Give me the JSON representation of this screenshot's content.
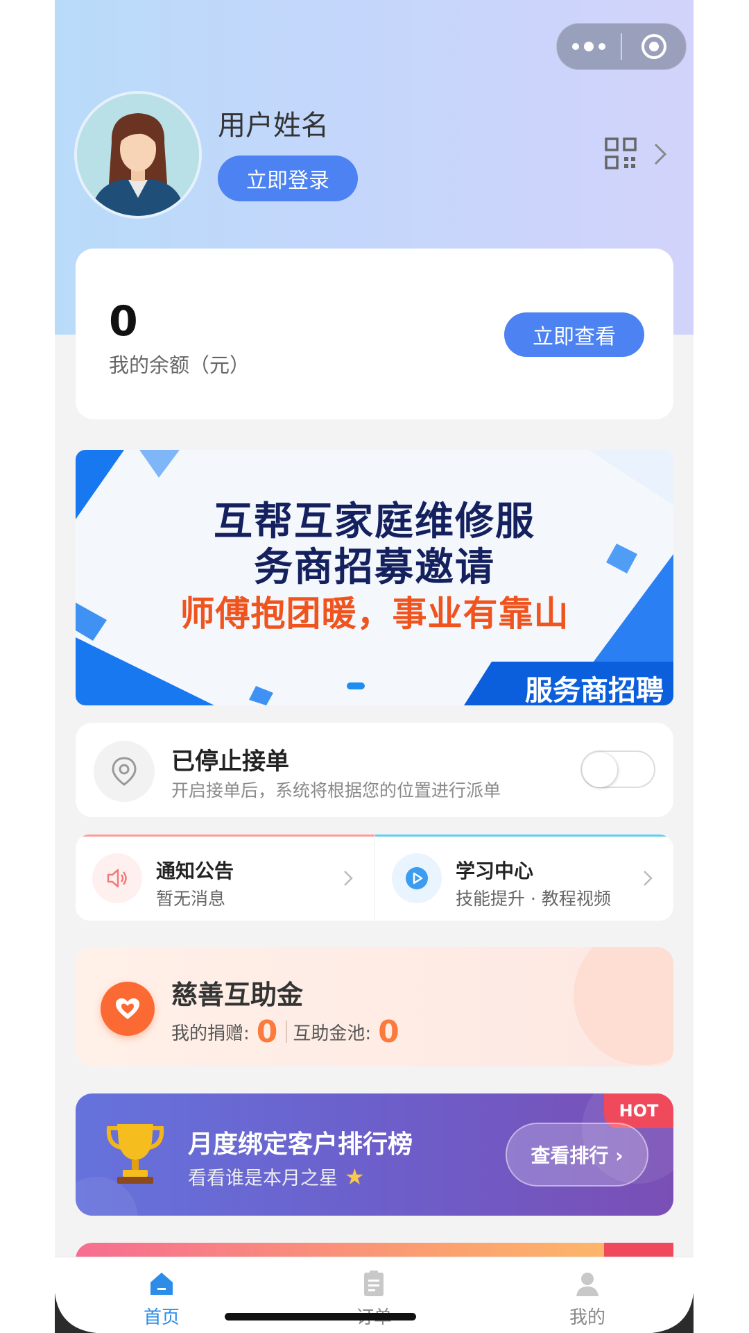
{
  "header": {
    "username": "用户姓名",
    "login_label": "立即登录",
    "capsule_more_icon": "more-dots-icon",
    "capsule_close_icon": "target-icon",
    "qr_icon": "qrcode-icon"
  },
  "balance": {
    "amount": "0",
    "label": "我的余额（元）",
    "view_label": "立即查看"
  },
  "banner": {
    "line1": "互帮互家庭维修服",
    "line2": "务商招募邀请",
    "line3": "师傅抱团暖，事业有靠山",
    "tag": "服务商招聘",
    "active_slide": 1,
    "slide_count": 1
  },
  "order_status": {
    "title": "已停止接单",
    "description": "开启接单后，系统将根据您的位置进行派单",
    "toggle_on": false,
    "icon": "location-pin-icon"
  },
  "quick_links": [
    {
      "title": "通知公告",
      "subtitle": "暂无消息",
      "icon": "speaker-icon",
      "accent": "#ff9a9a"
    },
    {
      "title": "学习中心",
      "subtitle": "技能提升 · 教程视频",
      "icon": "play-icon",
      "accent": "#5ccff2"
    }
  ],
  "charity": {
    "title": "慈善互助金",
    "my_donation_label": "我的捐赠:",
    "my_donation_value": "0",
    "pool_label": "互助金池:",
    "pool_value": "0",
    "icon": "heart-icon"
  },
  "ranking": {
    "badge": "HOT",
    "title": "月度绑定客户排行榜",
    "subtitle": "看看谁是本月之星",
    "button_label": "查看排行 ›",
    "icon": "trophy-icon"
  },
  "tabbar": {
    "items": [
      {
        "label": "首页",
        "icon": "home-icon",
        "active": true
      },
      {
        "label": "订单",
        "icon": "order-list-icon",
        "active": false
      },
      {
        "label": "我的",
        "icon": "user-icon",
        "active": false
      }
    ]
  },
  "colors": {
    "primary": "#4c82f1",
    "tab_active": "#2b8de8",
    "charity_accent": "#fb7a3c",
    "hot": "#f0495c"
  }
}
